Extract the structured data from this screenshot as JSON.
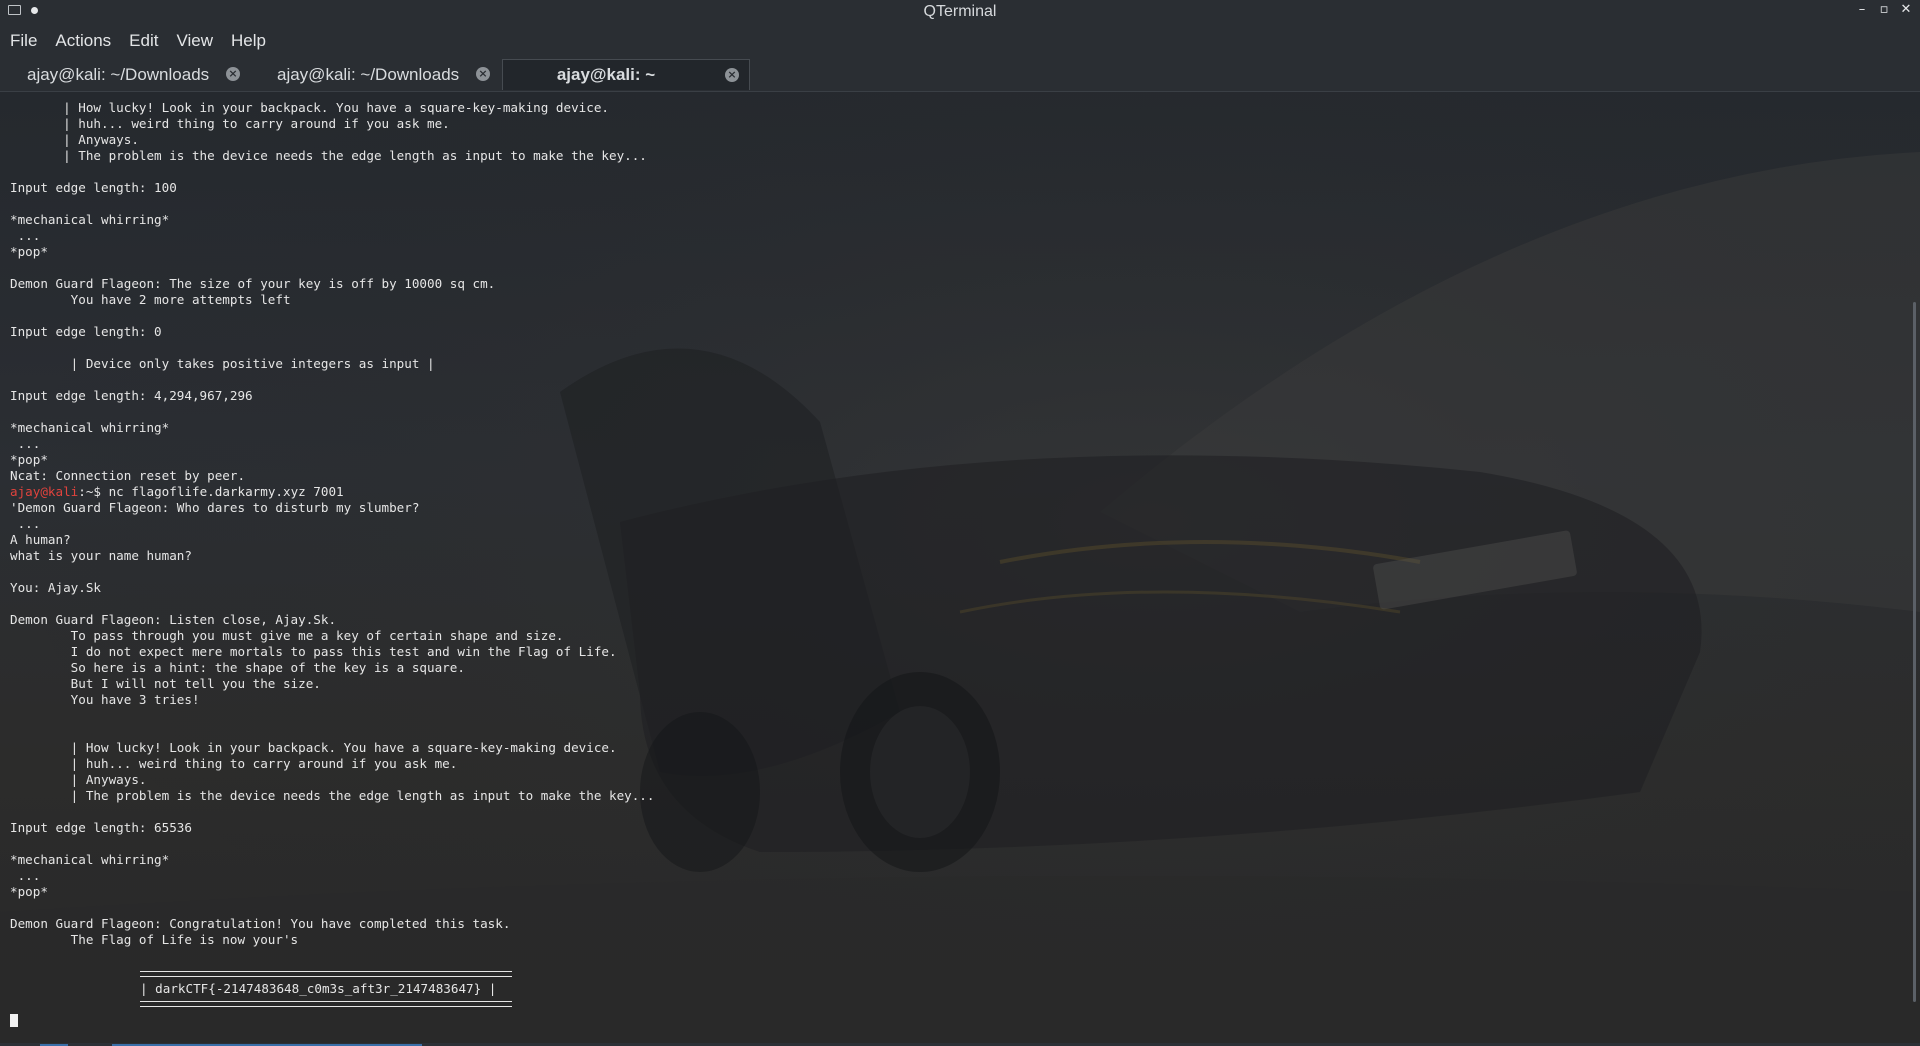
{
  "window": {
    "title": "QTerminal"
  },
  "menu": {
    "items": [
      "File",
      "Actions",
      "Edit",
      "View",
      "Help"
    ]
  },
  "tabs": [
    {
      "label": "ajay@kali: ~/Downloads",
      "active": false
    },
    {
      "label": "ajay@kali: ~/Downloads",
      "active": false
    },
    {
      "label": "ajay@kali: ~",
      "active": true
    }
  ],
  "terminal": {
    "lines": [
      "       | How lucky! Look in your backpack. You have a square-key-making device.",
      "       | huh... weird thing to carry around if you ask me.",
      "       | Anyways.",
      "       | The problem is the device needs the edge length as input to make the key...",
      "",
      "Input edge length: 100",
      "",
      "*mechanical whirring*",
      " ...",
      "*pop*",
      "",
      "Demon Guard Flageon: The size of your key is off by 10000 sq cm.",
      "        You have 2 more attempts left",
      "",
      "Input edge length: 0",
      "",
      "        | Device only takes positive integers as input |",
      "",
      "Input edge length: 4,294,967,296",
      "",
      "*mechanical whirring*",
      " ...",
      "*pop*",
      "Ncat: Connection reset by peer."
    ],
    "prompt_user": "ajay@kali",
    "prompt_path": ":~$ ",
    "command": "nc flagoflife.darkarmy.xyz 7001",
    "lines2": [
      "'Demon Guard Flageon: Who dares to disturb my slumber?",
      " ...",
      "A human?",
      "what is your name human?",
      "",
      "You: Ajay.Sk",
      "",
      "Demon Guard Flageon: Listen close, Ajay.Sk.",
      "        To pass through you must give me a key of certain shape and size.",
      "        I do not expect mere mortals to pass this test and win the Flag of Life.",
      "        So here is a hint: the shape of the key is a square.",
      "        But I will not tell you the size.",
      "        You have 3 tries!",
      "",
      "",
      "        | How lucky! Look in your backpack. You have a square-key-making device.",
      "        | huh... weird thing to carry around if you ask me.",
      "        | Anyways.",
      "        | The problem is the device needs the edge length as input to make the key...",
      "",
      "Input edge length: 65536",
      "",
      "*mechanical whirring*",
      " ...",
      "*pop*",
      "",
      "Demon Guard Flageon: Congratulation! You have completed this task.",
      "        The Flag of Life is now your's"
    ],
    "flag": "| darkCTF{-2147483648_c0m3s_aft3r_2147483647} |"
  }
}
